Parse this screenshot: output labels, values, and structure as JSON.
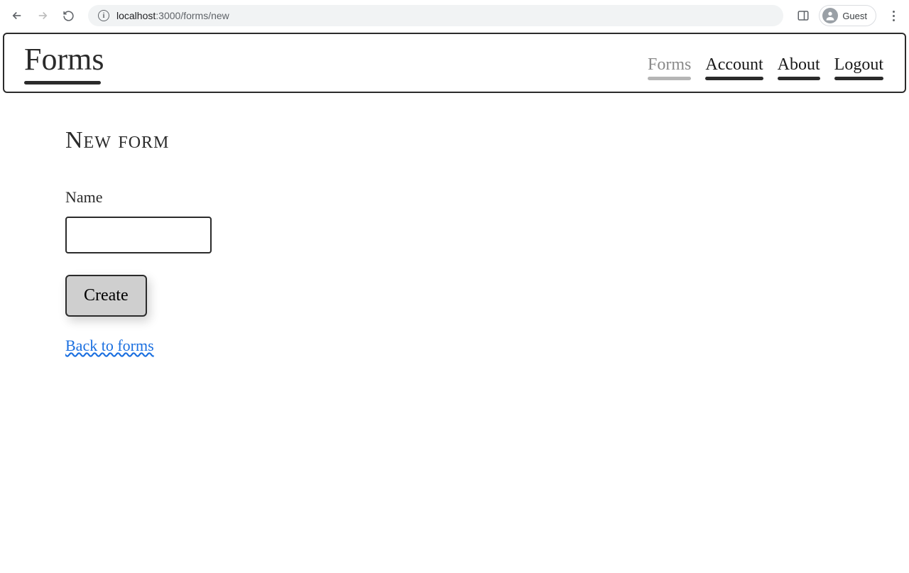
{
  "browser": {
    "url_host": "localhost",
    "url_port": ":3000",
    "url_path": "/forms/new",
    "profile_label": "Guest"
  },
  "header": {
    "brand": "Forms",
    "nav": {
      "forms": "Forms",
      "account": "Account",
      "about": "About",
      "logout": "Logout"
    }
  },
  "page": {
    "title": "New form",
    "name_label": "Name",
    "name_value": "",
    "create_label": "Create",
    "back_label": "Back to forms"
  }
}
